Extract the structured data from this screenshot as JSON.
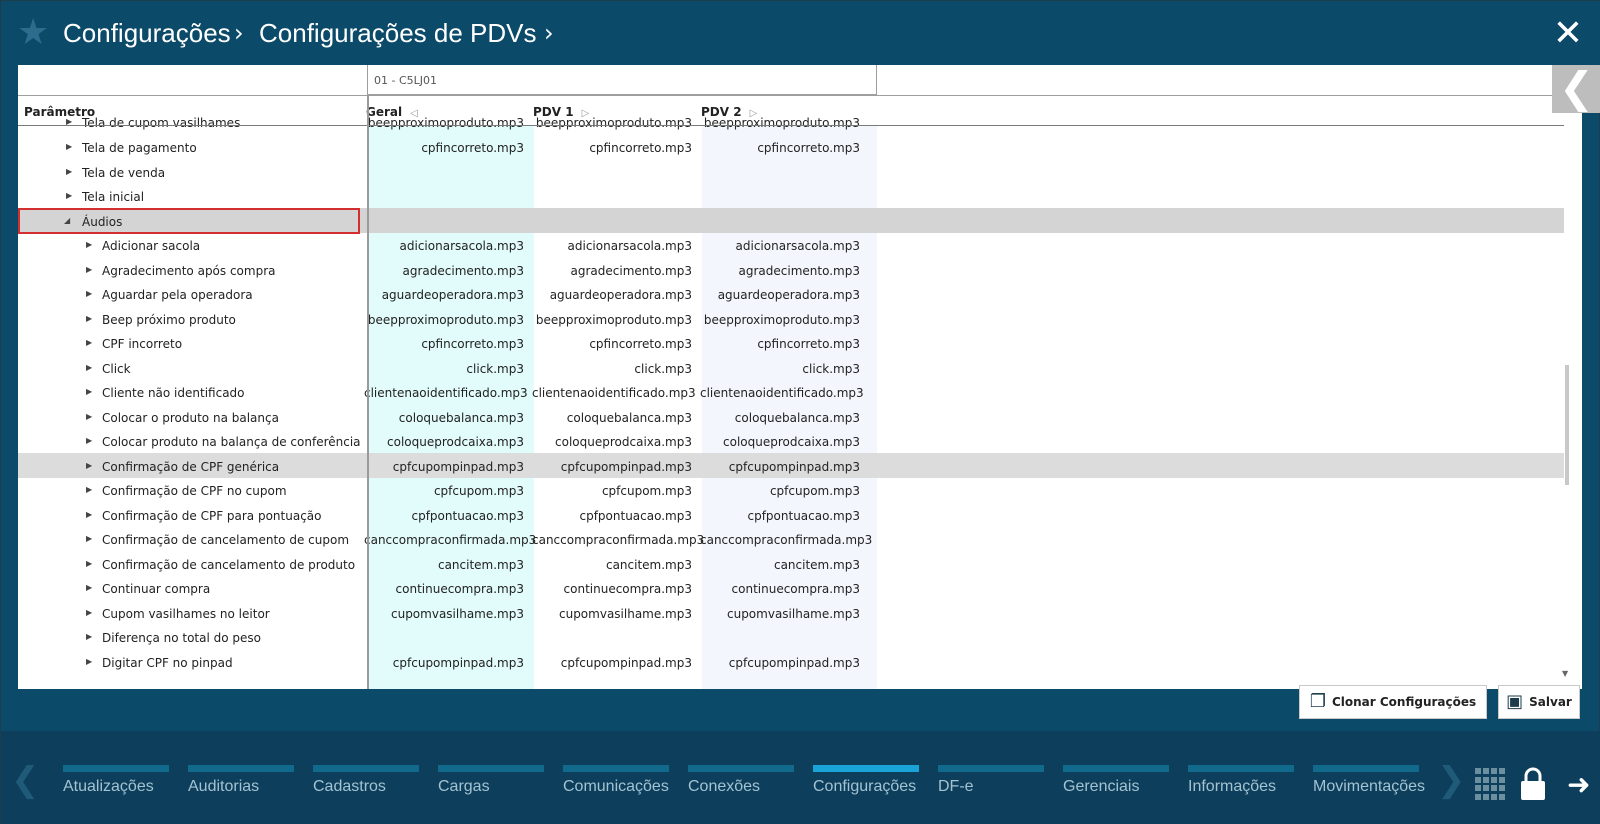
{
  "header": {
    "breadcrumb_1": "Configurações",
    "breadcrumb_2": "Configurações de PDVs",
    "separator": ">"
  },
  "table": {
    "store": "01 - C5LJ01",
    "columns": [
      "Parâmetro",
      "Geral",
      "PDV 1",
      "PDV 2"
    ],
    "rows": [
      {
        "label": "Tela de cupom vasilhames",
        "v": [
          "beepproximoproduto.mp3",
          "beepproximoproduto.mp3",
          "beepproximoproduto.mp3"
        ]
      },
      {
        "label": "Tela de pagamento",
        "v": [
          "cpfincorreto.mp3",
          "cpfincorreto.mp3",
          "cpfincorreto.mp3"
        ]
      },
      {
        "label": "Tela de venda",
        "v": [
          "",
          "",
          ""
        ]
      },
      {
        "label": "Tela inicial",
        "v": [
          "",
          "",
          ""
        ]
      },
      {
        "label": "Áudios",
        "v": [
          "",
          "",
          ""
        ]
      },
      {
        "label": "Adicionar sacola",
        "v": [
          "adicionarsacola.mp3",
          "adicionarsacola.mp3",
          "adicionarsacola.mp3"
        ]
      },
      {
        "label": "Agradecimento após compra",
        "v": [
          "agradecimento.mp3",
          "agradecimento.mp3",
          "agradecimento.mp3"
        ]
      },
      {
        "label": "Aguardar pela operadora",
        "v": [
          "aguardeoperadora.mp3",
          "aguardeoperadora.mp3",
          "aguardeoperadora.mp3"
        ]
      },
      {
        "label": "Beep próximo produto",
        "v": [
          "beepproximoproduto.mp3",
          "beepproximoproduto.mp3",
          "beepproximoproduto.mp3"
        ]
      },
      {
        "label": "CPF incorreto",
        "v": [
          "cpfincorreto.mp3",
          "cpfincorreto.mp3",
          "cpfincorreto.mp3"
        ]
      },
      {
        "label": "Click",
        "v": [
          "click.mp3",
          "click.mp3",
          "click.mp3"
        ]
      },
      {
        "label": "Cliente não identificado",
        "v": [
          "clientenaoidentificado.mp3",
          "clientenaoidentificado.mp3",
          "clientenaoidentificado.mp3"
        ]
      },
      {
        "label": "Colocar o produto na balança",
        "v": [
          "coloquebalanca.mp3",
          "coloquebalanca.mp3",
          "coloquebalanca.mp3"
        ]
      },
      {
        "label": "Colocar produto na balança de conferência",
        "v": [
          "coloqueprodcaixa.mp3",
          "coloqueprodcaixa.mp3",
          "coloqueprodcaixa.mp3"
        ]
      },
      {
        "label": "Confirmação de CPF genérica",
        "v": [
          "cpfcupompinpad.mp3",
          "cpfcupompinpad.mp3",
          "cpfcupompinpad.mp3"
        ]
      },
      {
        "label": "Confirmação de CPF no cupom",
        "v": [
          "cpfcupom.mp3",
          "cpfcupom.mp3",
          "cpfcupom.mp3"
        ]
      },
      {
        "label": "Confirmação de CPF para pontuação",
        "v": [
          "cpfpontuacao.mp3",
          "cpfpontuacao.mp3",
          "cpfpontuacao.mp3"
        ]
      },
      {
        "label": "Confirmação de cancelamento de cupom",
        "v": [
          "canccompraconfirmada.mp3",
          "canccompraconfirmada.mp3",
          "canccompraconfirmada.mp3"
        ]
      },
      {
        "label": "Confirmação de cancelamento de produto",
        "v": [
          "cancitem.mp3",
          "cancitem.mp3",
          "cancitem.mp3"
        ]
      },
      {
        "label": "Continuar compra",
        "v": [
          "continuecompra.mp3",
          "continuecompra.mp3",
          "continuecompra.mp3"
        ]
      },
      {
        "label": "Cupom vasilhames no leitor",
        "v": [
          "cupomvasilhame.mp3",
          "cupomvasilhame.mp3",
          "cupomvasilhame.mp3"
        ]
      },
      {
        "label": "Diferença no total do peso",
        "v": [
          "",
          "",
          ""
        ]
      },
      {
        "label": "Digitar CPF no pinpad",
        "v": [
          "cpfcupompinpad.mp3",
          "cpfcupompinpad.mp3",
          "cpfcupompinpad.mp3"
        ]
      }
    ]
  },
  "actions": {
    "clone_label": "Clonar Configurações",
    "save_label": "Salvar"
  },
  "nav": {
    "items": [
      "Atualizações",
      "Auditorias",
      "Cadastros",
      "Cargas",
      "Comunicações",
      "Conexões",
      "Configurações",
      "DF-e",
      "Gerenciais",
      "Informações",
      "Movimentações"
    ],
    "active": "Configurações"
  },
  "colors": {
    "header_bg": "#0b4a69",
    "nav_bg": "#0d3f5c",
    "nav_active": "#1aa3d6",
    "selection_border": "#d32f2f",
    "geral_column_bg": "#e2fbfb"
  }
}
